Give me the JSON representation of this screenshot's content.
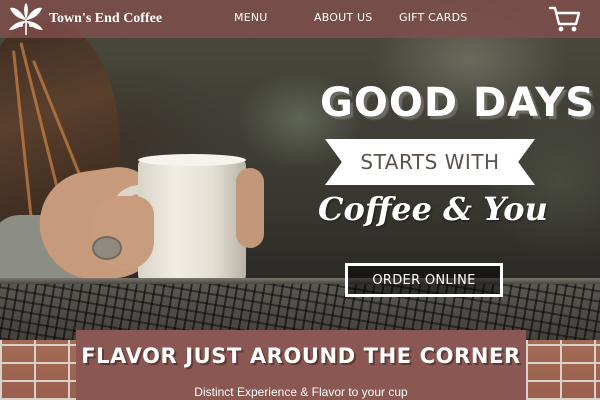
{
  "brand": {
    "name": "Town's End Coffee",
    "logo_icon": "coffee-plant-icon"
  },
  "nav": {
    "items": [
      {
        "label": "MENU"
      },
      {
        "label": "ABOUT US"
      },
      {
        "label": "GIFT CARDS"
      }
    ],
    "cart_icon": "shopping-cart-icon"
  },
  "hero": {
    "headline": "GOOD DAYS",
    "ribbon": "STARTS WITH",
    "script_line": "Coffee & You",
    "cta_label": "ORDER ONLINE"
  },
  "banner": {
    "title": "FLAVOR JUST AROUND THE CORNER",
    "subtitle": "Distinct Experience & Flavor to your cup"
  },
  "colors": {
    "nav_bg": "#804e4c",
    "banner_bg": "#8a5753",
    "text_light": "#ffffff"
  }
}
